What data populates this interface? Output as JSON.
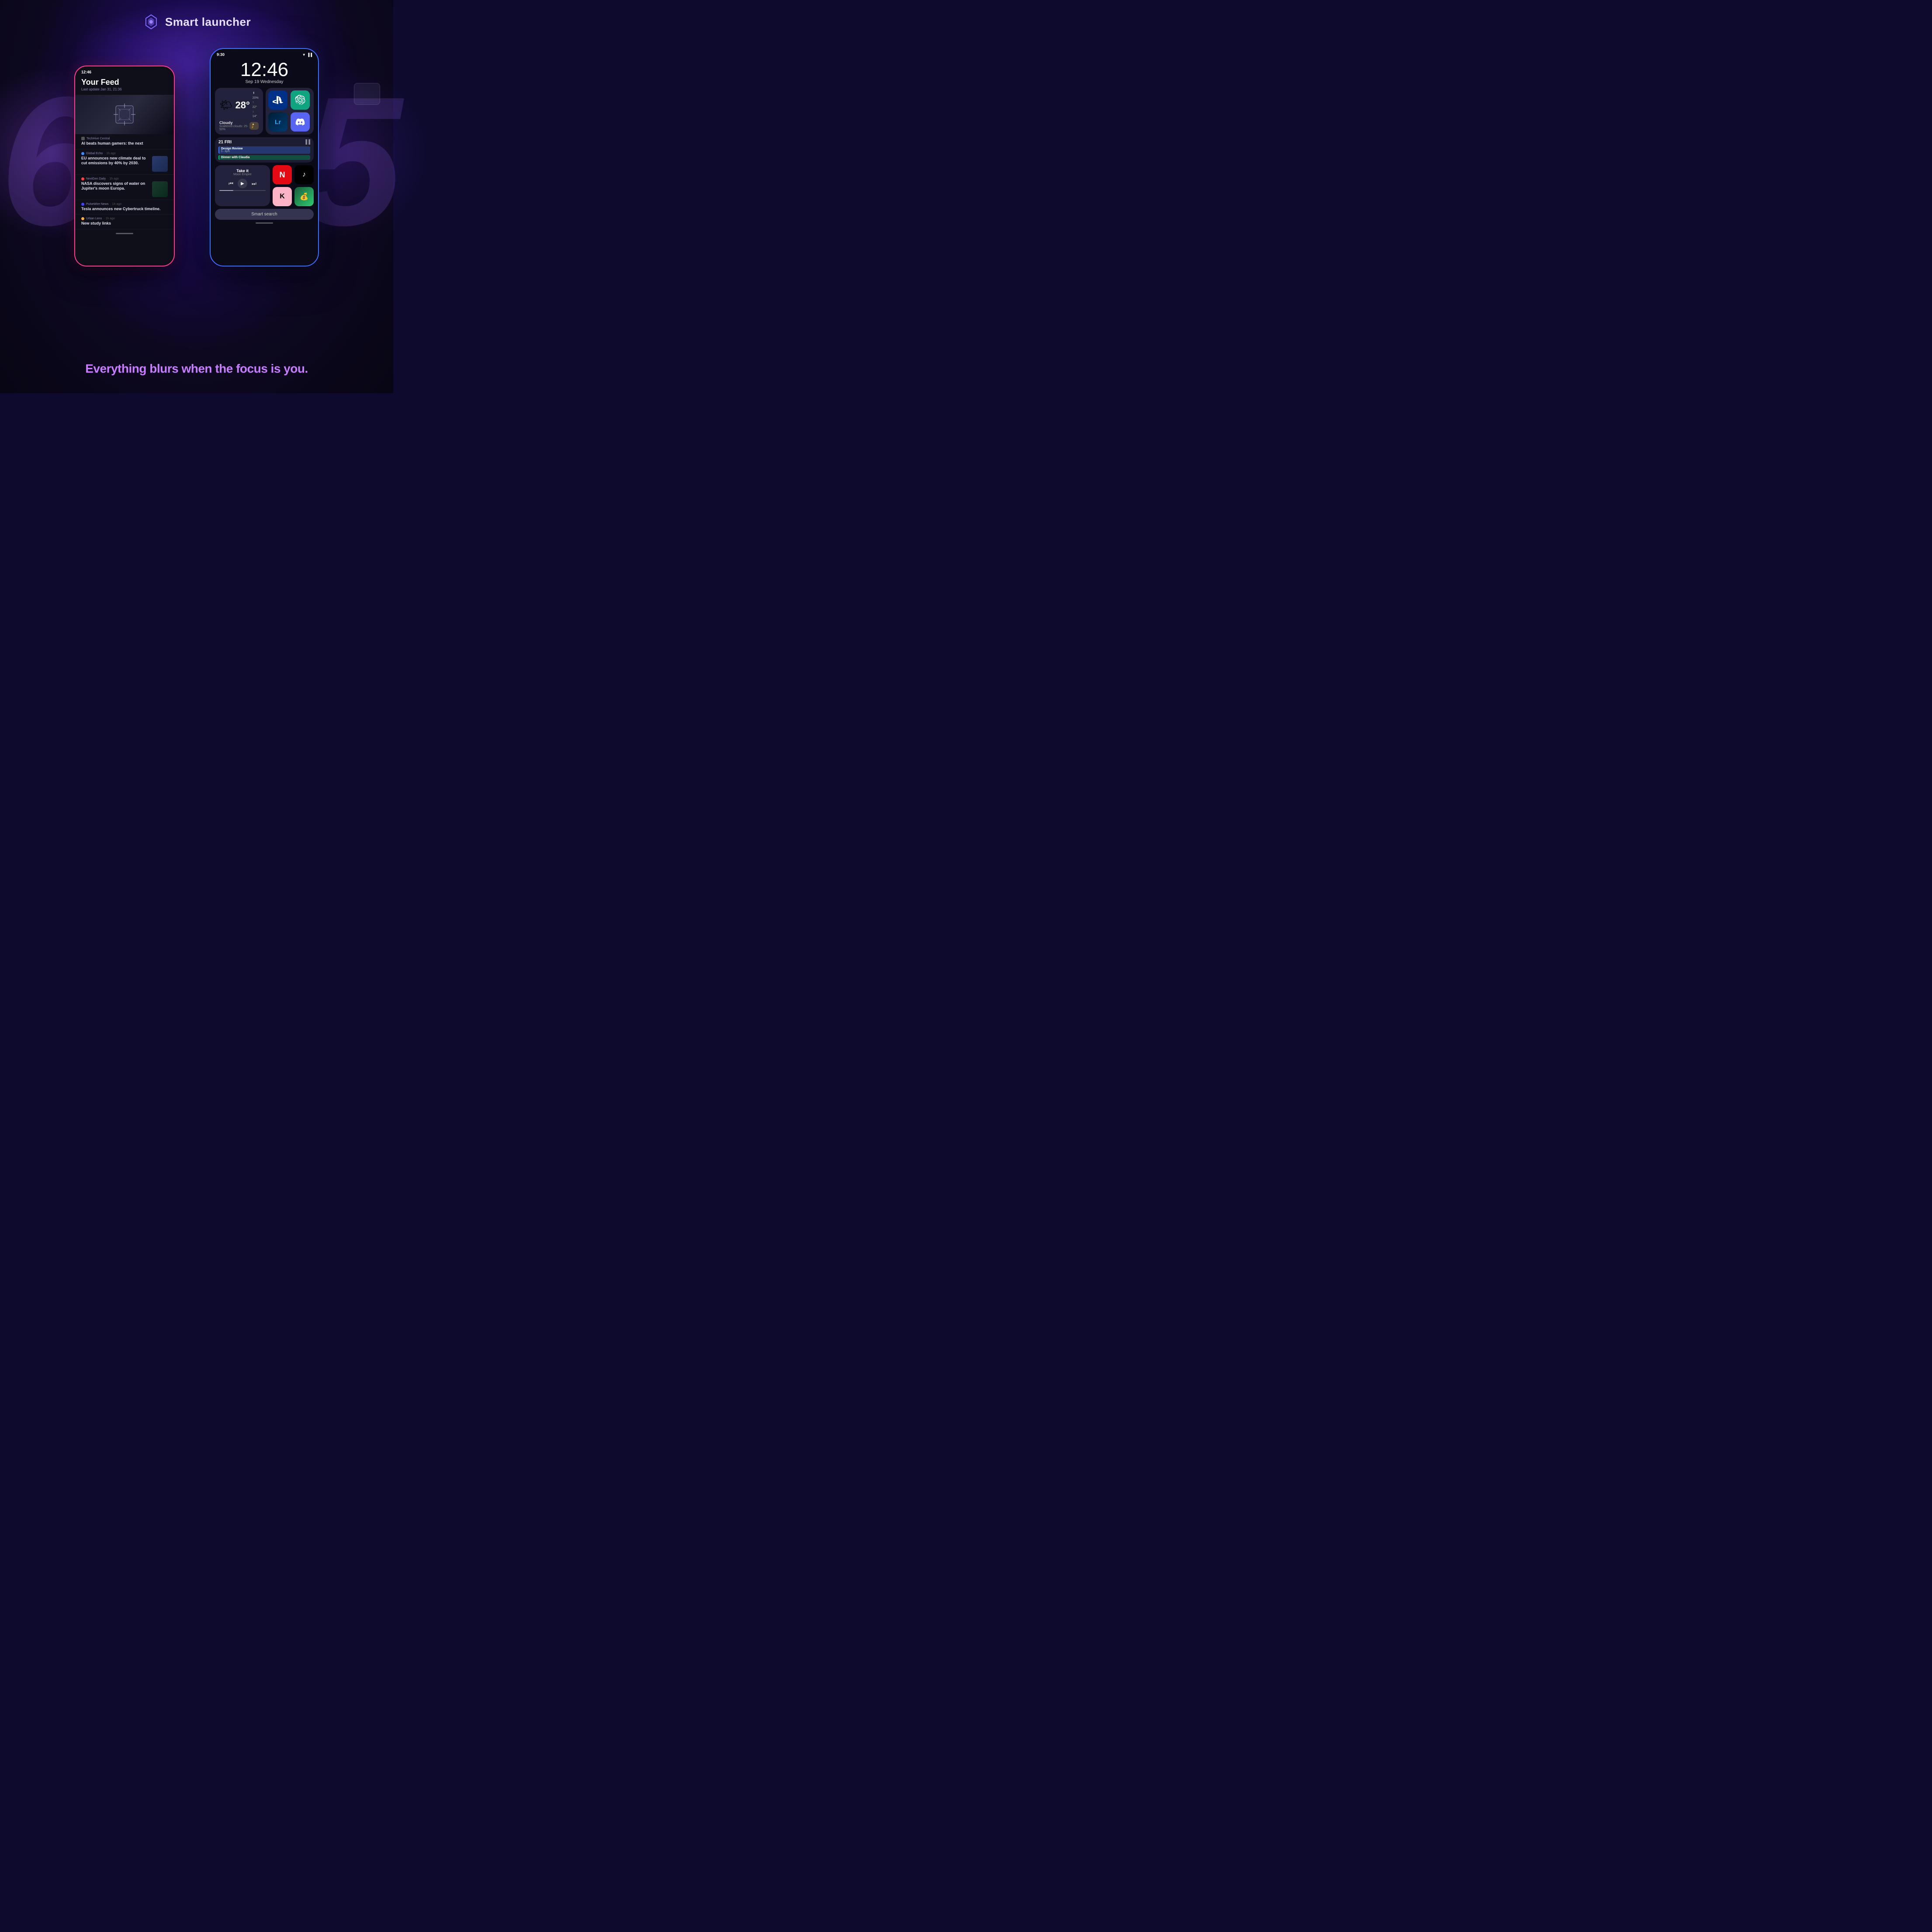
{
  "app": {
    "title": "Smart launcher",
    "logo_symbol": "◈"
  },
  "header": {
    "title": "Smart launcher"
  },
  "background": {
    "accent_color": "#7c4dff",
    "glow_color": "#3c1090"
  },
  "big_numbers": {
    "left": "6",
    "right": "5"
  },
  "phone_left": {
    "status_bar": {
      "time": "12:46"
    },
    "feed": {
      "title": "Your Feed",
      "subtitle": "Last update Jan 31, 21:36",
      "items": [
        {
          "source": "TechHive Central",
          "title": "AI beats human gamers: the next",
          "time": "",
          "color": "#888"
        },
        {
          "source": "Global Echo",
          "time": "1h ago",
          "title": "EU announces new climate deal to cut emissions by 40% by 2030.",
          "color": "#4488ff"
        },
        {
          "source": "NextGen Daily",
          "time": "1h ago",
          "title": "NASA discovers signs of water on Jupiter's moon Europa.",
          "color": "#ff4444"
        },
        {
          "source": "PulseWire News",
          "time": "1h ago",
          "title": "Tesla announces new Cybertruck timeline.",
          "color": "#4444ff"
        },
        {
          "source": "Urban Lens",
          "time": "1h ago",
          "title": "New study links",
          "color": "#ffaa44"
        }
      ]
    }
  },
  "phone_right": {
    "status_bar": {
      "time": "9:30",
      "signal": "▲▐"
    },
    "home": {
      "clock": "12:46",
      "date": "Sep 19 Wednesday",
      "weather": {
        "icon": "🌤",
        "temp": "28°",
        "condition": "Cloudy",
        "sub": "Scattered clouds: 25-50%",
        "humidity": "20%",
        "high": "22°",
        "low": "14°",
        "warning": "▲ 2"
      },
      "apps_grid": [
        {
          "name": "PlayStation",
          "color": "#003087",
          "icon": "🎮"
        },
        {
          "name": "ChatGPT",
          "color": "#10a37f",
          "icon": "🤖"
        },
        {
          "name": "Lightroom",
          "color": "#001e36",
          "icon": "📷"
        },
        {
          "name": "Discord",
          "color": "#5865f2",
          "icon": "💬"
        }
      ],
      "calendar": {
        "label": "21 FRI",
        "events": [
          {
            "title": "Design Review",
            "time": "5 - 6pm",
            "color": "#3c78ff"
          },
          {
            "title": "Dinner with Claudia",
            "time": "",
            "color": "#00c864"
          }
        ]
      },
      "music": {
        "title": "Take it",
        "artist": "Moon Empire"
      },
      "bottom_apps": [
        {
          "name": "Netflix",
          "color": "#e50914",
          "icon": "N"
        },
        {
          "name": "TikTok",
          "color": "#010101",
          "icon": "♪"
        },
        {
          "name": "Klarna",
          "color": "#ffb3c7",
          "icon": "K"
        },
        {
          "name": "Money App",
          "color": "#2ecc71",
          "icon": "💰"
        }
      ],
      "smart_search": "Smart search"
    }
  },
  "tagline": {
    "text": "Everything blurs when the focus is you."
  }
}
